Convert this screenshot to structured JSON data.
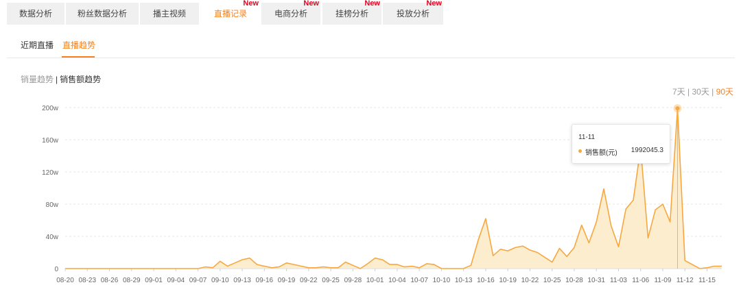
{
  "tabs": [
    {
      "label": "数据分析",
      "badge": ""
    },
    {
      "label": "粉丝数据分析",
      "badge": ""
    },
    {
      "label": "播主视频",
      "badge": ""
    },
    {
      "label": "直播记录",
      "badge": "New",
      "active": true
    },
    {
      "label": "电商分析",
      "badge": "New"
    },
    {
      "label": "挂榜分析",
      "badge": "New"
    },
    {
      "label": "投放分析",
      "badge": "New"
    }
  ],
  "subtabs": {
    "recent": "近期直播",
    "trend": "直播趋势"
  },
  "metric_switch": {
    "sales_volume": "销量趋势",
    "divider": "|",
    "sales_amount": "销售额趋势"
  },
  "range_switch": {
    "d7": "7天",
    "d30": "30天",
    "d90": "90天",
    "divider": "|"
  },
  "tooltip": {
    "date": "11-11",
    "series_name": "销售额(元)",
    "value": "1992045.3"
  },
  "colors": {
    "accent": "#f5821f",
    "line": "#f7a73e",
    "area": "#fcebc9",
    "badge": "#e4001e"
  },
  "chart_data": {
    "type": "area",
    "x": [
      "08-20",
      "08-21",
      "08-22",
      "08-23",
      "08-24",
      "08-25",
      "08-26",
      "08-27",
      "08-28",
      "08-29",
      "08-30",
      "08-31",
      "09-01",
      "09-02",
      "09-03",
      "09-04",
      "09-05",
      "09-06",
      "09-07",
      "09-08",
      "09-09",
      "09-10",
      "09-11",
      "09-12",
      "09-13",
      "09-14",
      "09-15",
      "09-16",
      "09-17",
      "09-18",
      "09-19",
      "09-20",
      "09-21",
      "09-22",
      "09-23",
      "09-24",
      "09-25",
      "09-26",
      "09-27",
      "09-28",
      "09-29",
      "09-30",
      "10-01",
      "10-02",
      "10-03",
      "10-04",
      "10-05",
      "10-06",
      "10-07",
      "10-08",
      "10-09",
      "10-10",
      "10-11",
      "10-12",
      "10-13",
      "10-14",
      "10-15",
      "10-16",
      "10-17",
      "10-18",
      "10-19",
      "10-20",
      "10-21",
      "10-22",
      "10-23",
      "10-24",
      "10-25",
      "10-26",
      "10-27",
      "10-28",
      "10-29",
      "10-30",
      "10-31",
      "11-01",
      "11-02",
      "11-03",
      "11-04",
      "11-05",
      "11-06",
      "11-07",
      "11-08",
      "11-09",
      "11-10",
      "11-11",
      "11-12",
      "11-13",
      "11-14",
      "11-15",
      "11-16",
      "11-17"
    ],
    "xticks": [
      "08-20",
      "08-23",
      "08-26",
      "08-29",
      "09-01",
      "09-04",
      "09-07",
      "09-10",
      "09-13",
      "09-16",
      "09-19",
      "09-22",
      "09-25",
      "09-28",
      "10-01",
      "10-04",
      "10-07",
      "10-10",
      "10-13",
      "10-16",
      "10-19",
      "10-22",
      "10-25",
      "10-28",
      "10-31",
      "11-03",
      "11-06",
      "11-09",
      "11-12",
      "11-15"
    ],
    "series": [
      {
        "values": [
          0,
          0,
          0,
          0,
          0,
          0,
          0,
          0,
          0,
          0,
          0,
          0,
          0,
          0,
          0,
          0,
          0,
          0,
          0,
          2,
          1,
          9,
          3,
          7,
          11,
          13,
          5,
          3,
          1,
          2,
          7,
          5,
          3,
          1,
          1,
          2,
          1,
          1,
          8,
          4,
          0,
          6,
          13,
          11,
          5,
          5,
          2,
          3,
          1,
          6,
          5,
          0,
          0,
          0,
          0,
          4,
          36,
          62,
          16,
          24,
          22,
          26,
          28,
          23,
          20,
          14,
          8,
          25,
          15,
          26,
          54,
          32,
          58,
          99,
          53,
          27,
          74,
          85,
          150,
          38,
          73,
          80,
          58,
          199,
          10,
          5,
          0,
          1,
          3,
          3
        ]
      }
    ],
    "yticks": [
      "0",
      "40w",
      "80w",
      "120w",
      "160w",
      "200w"
    ],
    "ylim": [
      0,
      200
    ],
    "unit": "w",
    "grid": true,
    "highlight": {
      "x": "11-11",
      "value": 1992045.3
    }
  }
}
